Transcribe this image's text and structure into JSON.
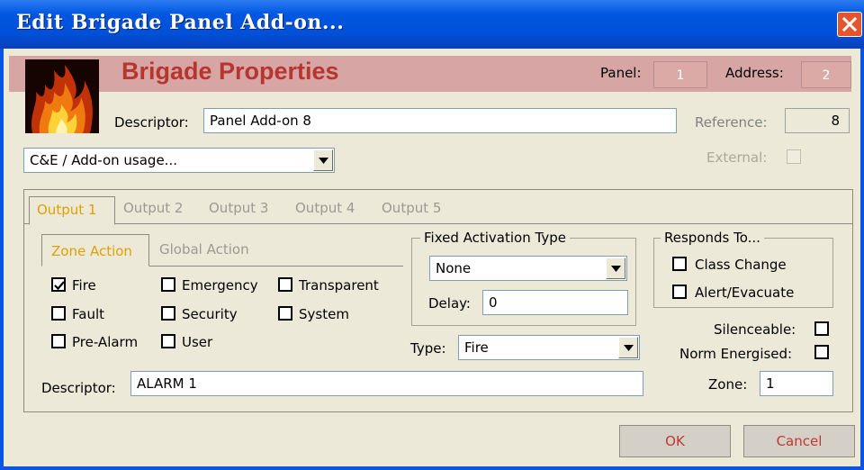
{
  "window": {
    "title": "Edit Brigade Panel Add-on..."
  },
  "header": {
    "title": "Brigade Properties",
    "panel_label": "Panel:",
    "panel_value": "1",
    "address_label": "Address:",
    "address_value": "2",
    "descriptor_label": "Descriptor:",
    "descriptor_value": "Panel Add-on 8",
    "reference_label": "Reference:",
    "reference_value": "8",
    "usage_select": "C&E / Add-on usage...",
    "external_label": "External:"
  },
  "tabs": [
    {
      "label": "Output 1",
      "active": true
    },
    {
      "label": "Output 2",
      "active": false
    },
    {
      "label": "Output 3",
      "active": false
    },
    {
      "label": "Output 4",
      "active": false
    },
    {
      "label": "Output 5",
      "active": false
    }
  ],
  "subtabs": [
    {
      "label": "Zone Action",
      "active": true
    },
    {
      "label": "Global Action",
      "active": false
    }
  ],
  "zone_actions": [
    {
      "label": "Fire",
      "checked": true
    },
    {
      "label": "Emergency",
      "checked": false
    },
    {
      "label": "Transparent",
      "checked": false
    },
    {
      "label": "Fault",
      "checked": false
    },
    {
      "label": "Security",
      "checked": false
    },
    {
      "label": "System",
      "checked": false
    },
    {
      "label": "Pre-Alarm",
      "checked": false
    },
    {
      "label": "User",
      "checked": false
    }
  ],
  "fixed_activation": {
    "title": "Fixed Activation Type",
    "selected": "None",
    "delay_label": "Delay:",
    "delay_value": "0"
  },
  "type": {
    "label": "Type:",
    "selected": "Fire"
  },
  "responds_to": {
    "title": "Responds To...",
    "class_change": "Class Change",
    "alert_evacuate": "Alert/Evacuate"
  },
  "silenceable_label": "Silenceable:",
  "norm_energised_label": "Norm Energised:",
  "zone": {
    "label": "Zone:",
    "value": "1"
  },
  "output_descriptor": {
    "label": "Descriptor:",
    "value": "ALARM 1"
  },
  "buttons": {
    "ok": "OK",
    "cancel": "Cancel"
  },
  "colors": {
    "title_bar": "#0054e3",
    "header_band": "#d7a6a4",
    "active_tab": "#e0a000",
    "button_text": "#c0382f"
  }
}
